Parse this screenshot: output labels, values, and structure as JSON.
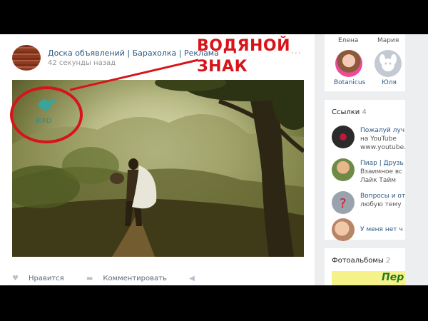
{
  "post": {
    "author": "Доска объявлений | Барахолка | Реклама",
    "time": "42 секунды назад",
    "more": "...",
    "watermark_label_line1": "ВОДЯНОЙ",
    "watermark_label_line2": "ЗНАК",
    "watermark_logo_text": "BIRD",
    "actions": {
      "like": "Нравится",
      "comment": "Комментировать"
    }
  },
  "friends": [
    {
      "name": "Елена",
      "sub": "Botanicus"
    },
    {
      "name": "Мария",
      "sub": "Юля"
    }
  ],
  "links": {
    "title": "Ссылки",
    "count": "4",
    "items": [
      {
        "line1": "Пожалуй луч",
        "line2": "на YouTube",
        "line3": "www.youtube."
      },
      {
        "line1": "Пиар | Друзь",
        "line2": "Взаимное вс",
        "line3": "Лайк Тайм"
      },
      {
        "line1": "Вопросы и от",
        "line2": "любую тему",
        "line3": ""
      },
      {
        "line1": "У меня нет ч",
        "line2": "",
        "line3": ""
      }
    ]
  },
  "albums": {
    "title": "Фотоальбомы",
    "count": "2",
    "thumb_text": "Пер"
  },
  "colors": {
    "accent_red": "#d7141a",
    "link_blue": "#2a5885",
    "page_bg": "#edeef0"
  }
}
